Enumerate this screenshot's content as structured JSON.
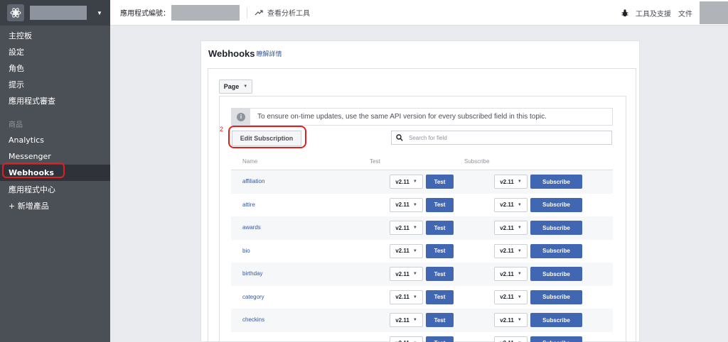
{
  "topbar": {
    "app_id_label": "應用程式編號：",
    "analytics": "查看分析工具",
    "support": "工具及支援",
    "docs": "文件"
  },
  "sidebar": {
    "items": [
      {
        "label": "主控板"
      },
      {
        "label": "設定"
      },
      {
        "label": "角色"
      },
      {
        "label": "提示"
      },
      {
        "label": "應用程式審查"
      }
    ],
    "section_label": "商品",
    "products": [
      {
        "label": "Analytics"
      },
      {
        "label": "Messenger"
      },
      {
        "label": "Webhooks"
      },
      {
        "label": "應用程式中心"
      },
      {
        "label": "+ 新增產品"
      }
    ]
  },
  "panel": {
    "title": "Webhooks",
    "learn_more": "瞭解詳情",
    "object_select": "Page",
    "notice": "To ensure on-time updates, use the same API version for every subscribed field in this topic.",
    "annotation_number": "2",
    "edit_button": "Edit Subscription",
    "search_placeholder": "Search for field",
    "columns": {
      "name": "Name",
      "test": "Test",
      "subscribe": "Subscribe"
    },
    "rows": [
      {
        "name": "affiliation",
        "version": "v2.11",
        "sub_version": "v2.11",
        "test": "Test",
        "subscribe": "Subscribe"
      },
      {
        "name": "attire",
        "version": "v2.11",
        "sub_version": "v2.11",
        "test": "Test",
        "subscribe": "Subscribe"
      },
      {
        "name": "awards",
        "version": "v2.11",
        "sub_version": "v2.11",
        "test": "Test",
        "subscribe": "Subscribe"
      },
      {
        "name": "bio",
        "version": "v2.11",
        "sub_version": "v2.11",
        "test": "Test",
        "subscribe": "Subscribe"
      },
      {
        "name": "birthday",
        "version": "v2.11",
        "sub_version": "v2.11",
        "test": "Test",
        "subscribe": "Subscribe"
      },
      {
        "name": "category",
        "version": "v2.11",
        "sub_version": "v2.11",
        "test": "Test",
        "subscribe": "Subscribe"
      },
      {
        "name": "checkins",
        "version": "v2.11",
        "sub_version": "v2.11",
        "test": "Test",
        "subscribe": "Subscribe"
      },
      {
        "name": "",
        "version": "v2.11",
        "sub_version": "v2.11",
        "test": "Test",
        "subscribe": "Subscribe"
      }
    ]
  },
  "colors": {
    "sidebar_bg": "#4b4f56",
    "accent": "#4267b2",
    "annotation": "#e02020"
  }
}
